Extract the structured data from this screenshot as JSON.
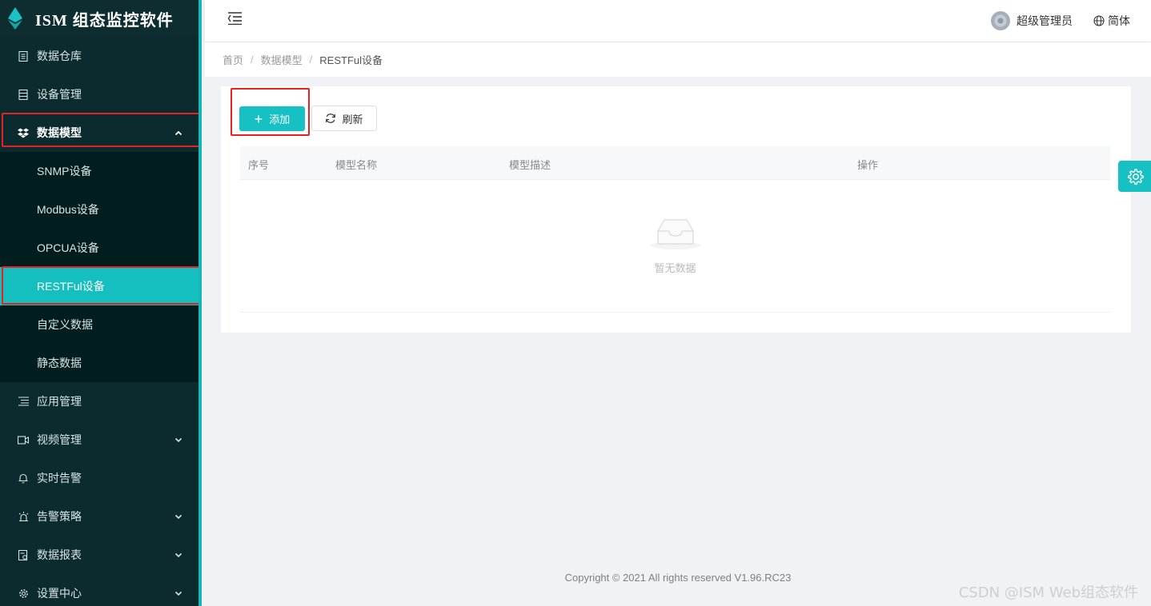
{
  "brand": {
    "title": "ISM 组态监控软件"
  },
  "sidebar": {
    "items": [
      {
        "label": "数据仓库",
        "icon": "document-icon"
      },
      {
        "label": "设备管理",
        "icon": "device-icon"
      },
      {
        "label": "数据模型",
        "icon": "dropbox-icon",
        "expanded": true
      },
      {
        "label": "应用管理",
        "icon": "list-icon"
      },
      {
        "label": "视频管理",
        "icon": "video-icon"
      },
      {
        "label": "实时告警",
        "icon": "bell-icon"
      },
      {
        "label": "告警策略",
        "icon": "alarm-icon"
      },
      {
        "label": "数据报表",
        "icon": "report-icon"
      },
      {
        "label": "设置中心",
        "icon": "gear-icon"
      }
    ],
    "submenu": [
      {
        "label": "SNMP设备"
      },
      {
        "label": "Modbus设备"
      },
      {
        "label": "OPCUA设备"
      },
      {
        "label": "RESTFul设备",
        "active": true
      },
      {
        "label": "自定义数据"
      },
      {
        "label": "静态数据"
      }
    ]
  },
  "header": {
    "user_name": "超级管理员",
    "language": "简体"
  },
  "breadcrumb": [
    "首页",
    "数据模型",
    "RESTFul设备"
  ],
  "toolbar": {
    "add_label": "添加",
    "refresh_label": "刷新"
  },
  "table": {
    "columns": [
      "序号",
      "模型名称",
      "模型描述",
      "操作"
    ],
    "rows": [],
    "empty_text": "暂无数据"
  },
  "footer": {
    "copyright": "Copyright © 2021 All rights reserved V1.96.RC23"
  },
  "watermark": "CSDN @ISM Web组态软件",
  "colors": {
    "accent": "#17c1c3",
    "sidebar_bg": "#0c2b2e",
    "highlight_box": "#e8231f"
  }
}
